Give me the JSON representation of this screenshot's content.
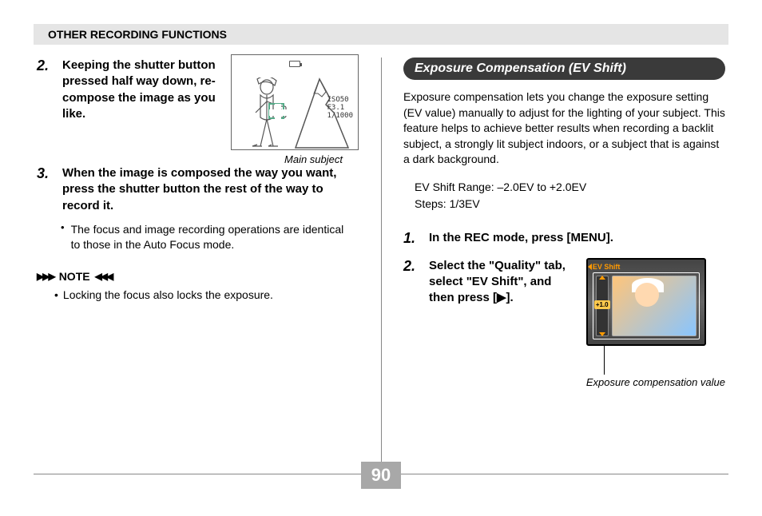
{
  "header": "OTHER RECORDING FUNCTIONS",
  "left": {
    "step2_num": "2.",
    "step2_text": "Keeping the shutter button pressed half way down, re-compose the image as you like.",
    "illus_caption": "Main subject",
    "cam_info": {
      "iso": "ISO50",
      "f": "F3.1",
      "speed": "1/1000"
    },
    "step3_num": "3.",
    "step3_text": "When the image is composed the way you want, press the shutter button the rest of the way to record it.",
    "bullet1": "The focus and image recording operations are identical to those in the Auto Focus mode.",
    "note_label": "NOTE",
    "note1": "Locking the focus also locks the exposure."
  },
  "right": {
    "section_title": "Exposure Compensation (EV Shift)",
    "para": "Exposure compensation lets you change the exposure setting (EV value) manually to adjust for the lighting of your subject. This feature helps to achieve better results when recording a backlit subject, a strongly lit subject indoors, or a subject that is against a dark background.",
    "spec_range": "EV Shift Range: –2.0EV to +2.0EV",
    "spec_steps": "Steps: 1/3EV",
    "step1_num": "1.",
    "step1_text": "In the REC mode, press [MENU].",
    "step2_num": "2.",
    "step2_text": "Select the \"Quality\" tab, select \"EV Shift\", and then press [▶].",
    "lcd_title": "EV Shift",
    "lcd_value": "+1.0",
    "lcd_caption": "Exposure compensation value"
  },
  "page_number": "90"
}
